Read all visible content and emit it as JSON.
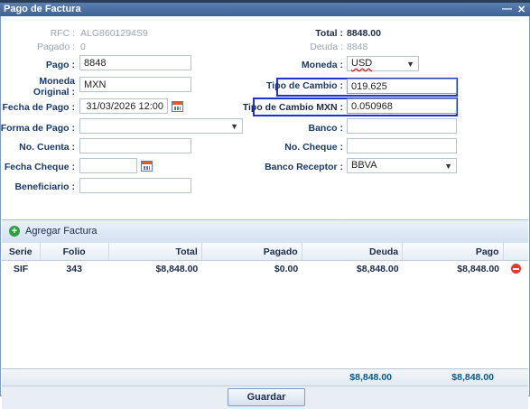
{
  "window": {
    "title": "Pago de Factura",
    "minimize_label": "—",
    "close_label": "✕"
  },
  "form": {
    "rfc_label": "RFC :",
    "rfc_value": "ALG8601294S9",
    "pagado_label": "Pagado :",
    "pagado_value": "0",
    "pago_label": "Pago :",
    "pago_value": "8848",
    "moneda_original_label_1": "Moneda",
    "moneda_original_label_2": "Original :",
    "moneda_original_value": "MXN",
    "fecha_pago_label": "Fecha de Pago :",
    "fecha_pago_value": "31/03/2026 12:00",
    "forma_pago_label": "Forma de Pago :",
    "forma_pago_value": "",
    "no_cuenta_label": "No. Cuenta :",
    "no_cuenta_value": "",
    "fecha_cheque_label": "Fecha Cheque :",
    "fecha_cheque_value": "",
    "beneficiario_label": "Beneficiario :",
    "beneficiario_value": "",
    "total_label": "Total :",
    "total_value": "8848.00",
    "deuda_label": "Deuda :",
    "deuda_value": "8848",
    "moneda_label": "Moneda :",
    "moneda_value": "USD",
    "tipo_cambio_label": "Tipo de Cambio :",
    "tipo_cambio_value": "019.625",
    "tipo_cambio_mxn_label": "Tipo de Cambio MXN :",
    "tipo_cambio_mxn_value": "0.050968",
    "banco_label": "Banco :",
    "banco_value": "",
    "no_cheque_label": "No. Cheque :",
    "no_cheque_value": "",
    "banco_receptor_label": "Banco Receptor :",
    "banco_receptor_value": "BBVA"
  },
  "grid": {
    "add_label": "Agregar Factura",
    "columns": [
      "Serie",
      "Folio",
      "Total",
      "Pagado",
      "Deuda",
      "Pago"
    ],
    "rows": [
      {
        "serie": "SIF",
        "folio": "343",
        "total": "$8,848.00",
        "pagado": "$0.00",
        "deuda": "$8,848.00",
        "pago": "$8,848.00"
      }
    ],
    "totals": {
      "deuda": "$8,848.00",
      "pago": "$8,848.00"
    }
  },
  "footer": {
    "guardar_label": "Guardar"
  },
  "colors": {
    "highlight_border": "#1e32d6",
    "title_bar": "#3d6298",
    "totals_text": "#0a5a8a"
  }
}
